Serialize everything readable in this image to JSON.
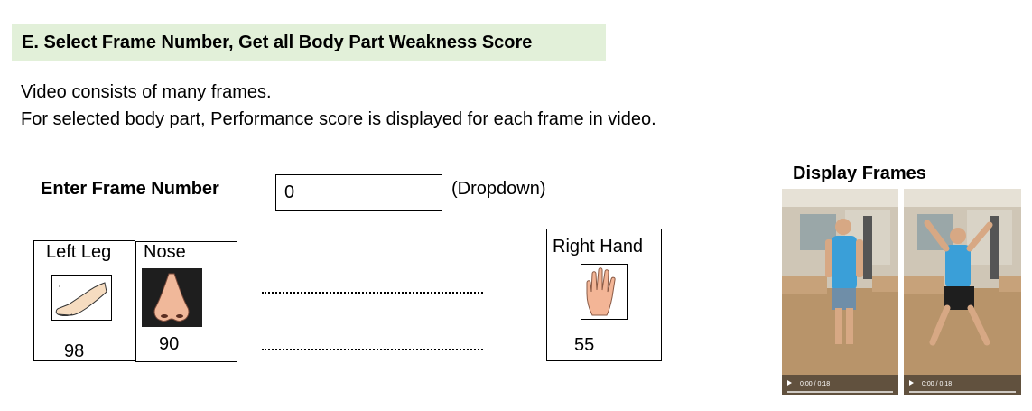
{
  "header": {
    "title": "E. Select Frame Number, Get all Body Part Weakness Score"
  },
  "description": {
    "line1": "Video consists of many frames.",
    "line2": "For selected body part, Performance score is displayed for each frame in video."
  },
  "frame_selector": {
    "label": "Enter Frame Number",
    "value": "0",
    "note": "(Dropdown)"
  },
  "body_parts": [
    {
      "label": "Left Leg",
      "score": "98",
      "icon": "leg-icon"
    },
    {
      "label": "Nose",
      "score": "90",
      "icon": "nose-icon"
    },
    {
      "label": "Right Hand",
      "score": "55",
      "icon": "hand-icon"
    }
  ],
  "display": {
    "title": "Display Frames",
    "videos": [
      {
        "time": "0:00 / 0:18"
      },
      {
        "time": "0:00 / 0:18"
      }
    ]
  },
  "colors": {
    "header_bg": "#e2f0d9",
    "skin": "#f3c7a3",
    "shirt": "#3a9fd8",
    "floor": "#b8946a"
  }
}
